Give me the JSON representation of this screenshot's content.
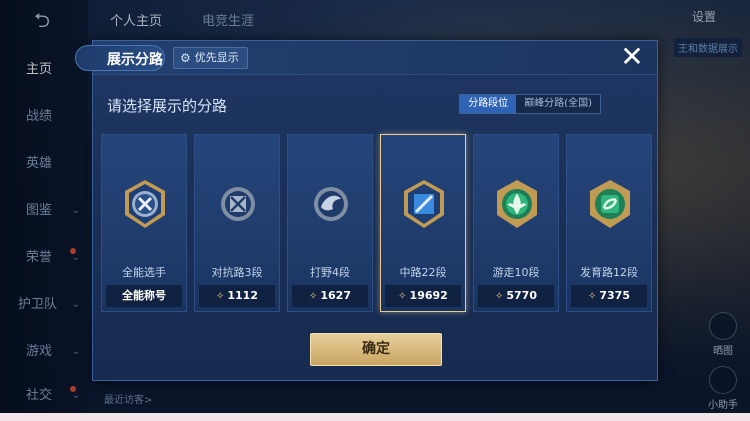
{
  "background": {
    "back_icon": "back-arrow-icon",
    "top_tabs": [
      "个人主页",
      "电竞生涯"
    ],
    "settings_label": "设置",
    "right_tag": "王和数据展示",
    "sidebar_items": [
      {
        "label": "主页",
        "active": true
      },
      {
        "label": "战绩"
      },
      {
        "label": "英雄"
      },
      {
        "label": "图鉴",
        "chevron": true
      },
      {
        "label": "荣誉",
        "chevron": true
      },
      {
        "label": "护卫队",
        "chevron": true
      },
      {
        "label": "游戏",
        "chevron": true
      },
      {
        "label": "社交",
        "chevron": true
      }
    ],
    "right_buttons": [
      "晒图",
      "小助手"
    ],
    "bottom_text": "最近访客>"
  },
  "modal": {
    "title": "展示分路",
    "priority_label": "优先显示",
    "priority_icon": "gear-icon",
    "close_icon": "close-icon",
    "prompt": "请选择展示的分路",
    "toggle": {
      "options": [
        "分路段位",
        "巅峰分路(全国)"
      ],
      "selected": "分路段位"
    },
    "cards": [
      {
        "name": "全能选手",
        "score": "全能称号",
        "icon": "all-rounder-emblem-icon",
        "accent": "#c9d5e6",
        "has_star": false,
        "selected": false
      },
      {
        "name": "对抗路3段",
        "score": "1112",
        "icon": "clash-lane-emblem-icon",
        "accent": "#b7c3d3",
        "has_star": true,
        "selected": false
      },
      {
        "name": "打野4段",
        "score": "1627",
        "icon": "jungle-emblem-icon",
        "accent": "#b7c3d3",
        "has_star": true,
        "selected": false
      },
      {
        "name": "中路22段",
        "score": "19692",
        "icon": "mid-lane-emblem-icon",
        "accent": "#3a8be0",
        "has_star": true,
        "selected": true
      },
      {
        "name": "游走10段",
        "score": "5770",
        "icon": "roam-emblem-icon",
        "accent": "#2fb67a",
        "has_star": true,
        "selected": false
      },
      {
        "name": "发育路12段",
        "score": "7375",
        "icon": "farm-lane-emblem-icon",
        "accent": "#2fb67a",
        "has_star": true,
        "selected": false
      }
    ],
    "confirm_label": "确定"
  },
  "colors": {
    "modal_bg": "#1b325c",
    "selected_border": "#e6c993",
    "confirm_gold": "#d9ba7d",
    "toggle_active": "#2f63b5"
  }
}
